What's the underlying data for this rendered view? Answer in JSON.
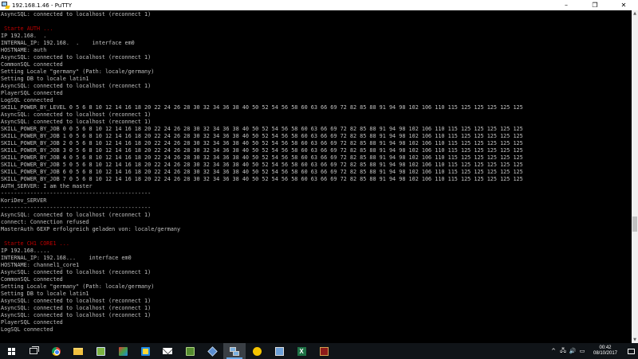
{
  "window": {
    "title": "192.168.1.46 - PuTTY",
    "controls": {
      "minimize": "–",
      "maximize": "❐",
      "close": "✕"
    }
  },
  "terminal": {
    "lines": [
      {
        "text": "AsyncSQL: connected to localhost (reconnect 1)"
      },
      {
        "text": ""
      },
      {
        "text": " Starte AUTH ...",
        "color": "red"
      },
      {
        "text": "IP 192.168.  ."
      },
      {
        "text": "INTERNAL_IP: 192.168.  .    interface em0"
      },
      {
        "text": "HOSTNAME: auth"
      },
      {
        "text": "AsyncSQL: connected to localhost (reconnect 1)"
      },
      {
        "text": "CommonSQL connected"
      },
      {
        "text": "Setting Locale \"germany\" (Path: locale/germany)"
      },
      {
        "text": "Setting DB to locale latin1"
      },
      {
        "text": "AsyncSQL: connected to localhost (reconnect 1)"
      },
      {
        "text": "PlayerSQL connected"
      },
      {
        "text": "LogSQL connected"
      },
      {
        "text": "SKILL_POWER_BY_LEVEL 0 5 6 8 10 12 14 16 18 20 22 24 26 28 30 32 34 36 38 40 50 52 54 56 58 60 63 66 69 72 82 85 88 91 94 98 102 106 110 115 125 125 125 125 125"
      },
      {
        "text": "AsyncSQL: connected to localhost (reconnect 1)"
      },
      {
        "text": "AsyncSQL: connected to localhost (reconnect 1)"
      },
      {
        "text": "SKILL_POWER_BY_JOB 0 0 5 6 8 10 12 14 16 18 20 22 24 26 28 30 32 34 36 38 40 50 52 54 56 58 60 63 66 69 72 82 85 88 91 94 98 102 106 110 115 125 125 125 125 125"
      },
      {
        "text": "SKILL_POWER_BY_JOB 1 0 5 6 8 10 12 14 16 18 20 22 24 26 28 30 32 34 36 38 40 50 52 54 56 58 60 63 66 69 72 82 85 88 91 94 98 102 106 110 115 125 125 125 125 125"
      },
      {
        "text": "SKILL_POWER_BY_JOB 2 0 5 6 8 10 12 14 16 18 20 22 24 26 28 30 32 34 36 38 40 50 52 54 56 58 60 63 66 69 72 82 85 88 91 94 98 102 106 110 115 125 125 125 125 125"
      },
      {
        "text": "SKILL_POWER_BY_JOB 3 0 5 6 8 10 12 14 16 18 20 22 24 26 28 30 32 34 36 38 40 50 52 54 56 58 60 63 66 69 72 82 85 88 91 94 98 102 106 110 115 125 125 125 125 125"
      },
      {
        "text": "SKILL_POWER_BY_JOB 4 0 5 6 8 10 12 14 16 18 20 22 24 26 28 30 32 34 36 38 40 50 52 54 56 58 60 63 66 69 72 82 85 88 91 94 98 102 106 110 115 125 125 125 125 125"
      },
      {
        "text": "SKILL_POWER_BY_JOB 5 0 5 6 8 10 12 14 16 18 20 22 24 26 28 30 32 34 36 38 40 50 52 54 56 58 60 63 66 69 72 82 85 88 91 94 98 102 106 110 115 125 125 125 125 125"
      },
      {
        "text": "SKILL_POWER_BY_JOB 6 0 5 6 8 10 12 14 16 18 20 22 24 26 28 30 32 34 36 38 40 50 52 54 56 58 60 63 66 69 72 82 85 88 91 94 98 102 106 110 115 125 125 125 125 125"
      },
      {
        "text": "SKILL_POWER_BY_JOB 7 0 5 6 8 10 12 14 16 18 20 22 24 26 28 30 32 34 36 38 40 50 52 54 56 58 60 63 66 69 72 82 85 88 91 94 98 102 106 110 115 125 125 125 125 125"
      },
      {
        "text": "AUTH_SERVER: I am the master"
      },
      {
        "text": "----------------------------------------------"
      },
      {
        "text": "KoriDev_SERVER"
      },
      {
        "text": "----------------------------------------------"
      },
      {
        "text": "AsyncSQL: connected to localhost (reconnect 1)"
      },
      {
        "text": "connect: Connection refused"
      },
      {
        "text": "MasterAuth 6EXP erfolgreich geladen von: locale/germany"
      },
      {
        "text": ""
      },
      {
        "text": " Starte CH1 CORE1 ...",
        "color": "red"
      },
      {
        "text": "IP 192.168....."
      },
      {
        "text": "INTERNAL_IP: 192.168...    interface em0"
      },
      {
        "text": "HOSTNAME: channel1_core1"
      },
      {
        "text": "AsyncSQL: connected to localhost (reconnect 1)"
      },
      {
        "text": "CommonSQL connected"
      },
      {
        "text": "Setting Locale \"germany\" (Path: locale/germany)"
      },
      {
        "text": "Setting DB to locale latin1"
      },
      {
        "text": "AsyncSQL: connected to localhost (reconnect 1)"
      },
      {
        "text": "AsyncSQL: connected to localhost (reconnect 1)"
      },
      {
        "text": "AsyncSQL: connected to localhost (reconnect 1)"
      },
      {
        "text": "PlayerSQL connected"
      },
      {
        "text": "LogSQL connected"
      }
    ],
    "colors": {
      "default": "#c0c0c0",
      "red": "#c00000",
      "background": "#000000"
    }
  },
  "scrollbar": {
    "position": 0.62
  },
  "taskbar": {
    "apps": [
      {
        "name": "start-button",
        "icon": "windows-logo-icon"
      },
      {
        "name": "task-view-button",
        "icon": "task-view-icon"
      },
      {
        "name": "chrome-button",
        "icon": "chrome-icon"
      },
      {
        "name": "file-explorer-button",
        "icon": "folder-icon"
      },
      {
        "name": "notepad-plus-button",
        "icon": "notepad-icon"
      },
      {
        "name": "app-button-1",
        "icon": "colorful-app-icon"
      },
      {
        "name": "app-button-2",
        "icon": "yellow-blue-app-icon"
      },
      {
        "name": "mail-button",
        "icon": "mail-icon"
      },
      {
        "name": "app-button-3",
        "icon": "green-app-icon"
      },
      {
        "name": "virtualbox-button",
        "icon": "virtualbox-icon"
      },
      {
        "name": "putty-button",
        "icon": "putty-icon",
        "active": true
      },
      {
        "name": "winscp-button",
        "icon": "winscp-icon"
      },
      {
        "name": "puttygen-button",
        "icon": "puttygen-icon"
      },
      {
        "name": "excel-button",
        "icon": "excel-icon"
      },
      {
        "name": "game-button",
        "icon": "game-icon"
      }
    ],
    "tray": {
      "chevron": "^",
      "network": "🖧",
      "volume": "🔊",
      "keyboard": "▭"
    },
    "clock": {
      "time": "00:42",
      "date": "08/10/2017"
    },
    "accent": "#6aa8e8"
  }
}
